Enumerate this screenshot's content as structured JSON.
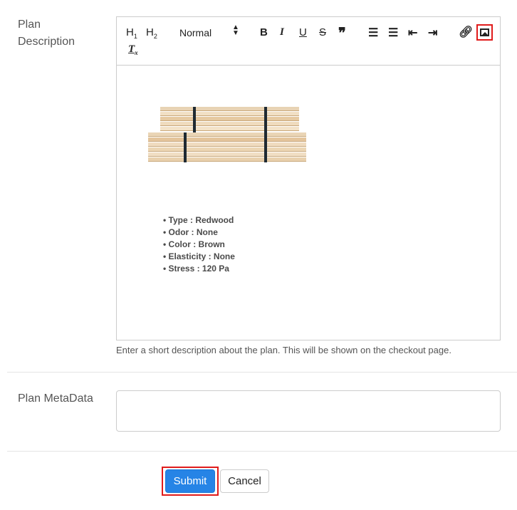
{
  "description": {
    "label_line1": "Plan",
    "label_line2": "Description",
    "toolbar": {
      "h1": "H1",
      "h2": "H2",
      "format_select": "Normal",
      "bold": "B",
      "italic": "I",
      "underline": "U",
      "strike": "S",
      "quote": "❞",
      "clear_format": "Tx"
    },
    "content": {
      "image_alt": "stacked lumber planks",
      "bullets": [
        "Type : Redwood",
        "Odor : None",
        "Color : Brown",
        "Elasticity : None",
        "Stress : 120 Pa"
      ]
    },
    "help": "Enter a short description about the plan. This will be shown on the checkout page."
  },
  "metadata": {
    "label": "Plan MetaData",
    "value": ""
  },
  "actions": {
    "submit": "Submit",
    "cancel": "Cancel"
  },
  "colors": {
    "primary": "#2684e6",
    "highlight": "#e01b1b"
  }
}
